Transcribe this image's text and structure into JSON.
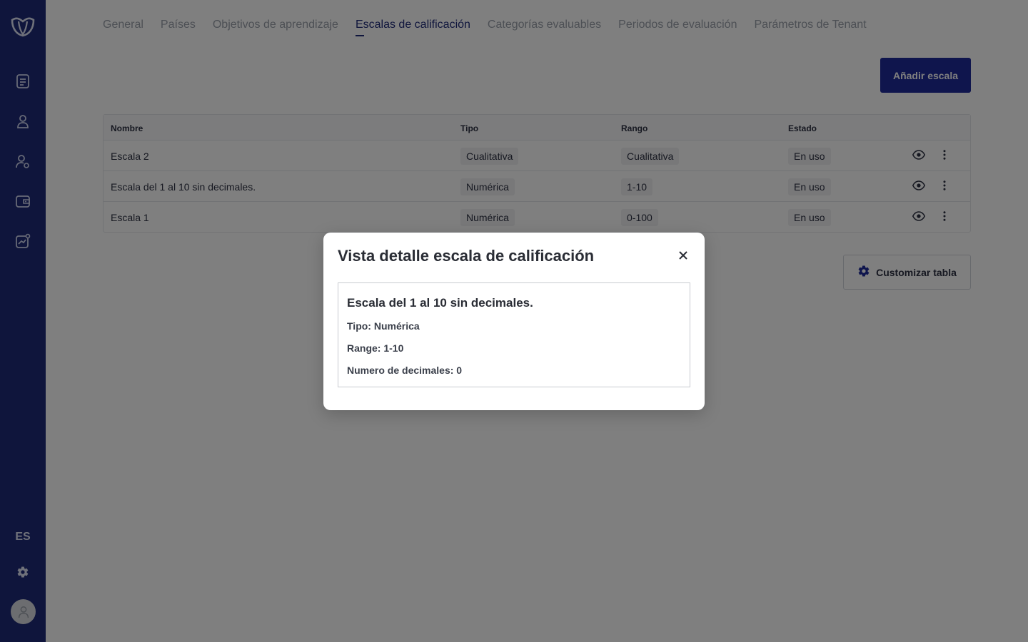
{
  "sidebar": {
    "items": [
      {
        "icon": "document-list-icon"
      },
      {
        "icon": "user-icon"
      },
      {
        "icon": "user-settings-icon"
      },
      {
        "icon": "wallet-icon"
      },
      {
        "icon": "chart-badge-icon"
      }
    ],
    "language": "ES"
  },
  "tabs": [
    {
      "label": "General"
    },
    {
      "label": "Países"
    },
    {
      "label": "Objetivos de aprendizaje"
    },
    {
      "label": "Escalas de calificación",
      "active": true
    },
    {
      "label": "Categorías evaluables"
    },
    {
      "label": "Periodos de evaluación"
    },
    {
      "label": "Parámetros de Tenant"
    }
  ],
  "toolbar": {
    "add_label": "Añadir escala"
  },
  "table": {
    "headers": {
      "name": "Nombre",
      "type": "Tipo",
      "range": "Rango",
      "status": "Estado"
    },
    "rows": [
      {
        "name": "Escala 2",
        "type": "Cualitativa",
        "range": "Cualitativa",
        "status": "En uso"
      },
      {
        "name": "Escala del 1 al 10 sin decimales.",
        "type": "Numérica",
        "range": "1-10",
        "status": "En uso"
      },
      {
        "name": "Escala 1",
        "type": "Numérica",
        "range": "0-100",
        "status": "En uso"
      }
    ]
  },
  "customize": {
    "label": "Customizar tabla"
  },
  "modal": {
    "title": "Vista detalle escala de calificación",
    "scale_name": "Escala del 1 al 10 sin decimales.",
    "type_line": "Tipo: Numérica",
    "range_line": "Range: 1-10",
    "decimals_line": "Numero de decimales: 0"
  },
  "colors": {
    "primary": "#1e2a78",
    "button": "#1e2a9a",
    "overlay": "rgba(0,0,0,0.5)"
  }
}
